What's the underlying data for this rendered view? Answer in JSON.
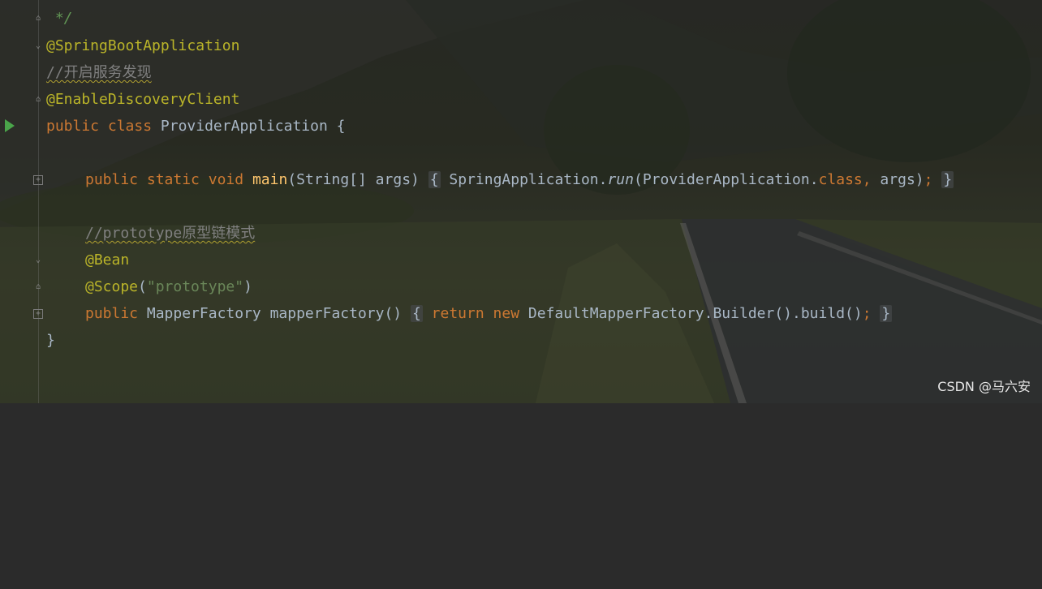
{
  "editor": {
    "lines": [
      {
        "text": " */"
      },
      {
        "text": "@SpringBootApplication"
      },
      {
        "text": "//开启服务发现"
      },
      {
        "text": "@EnableDiscoveryClient"
      },
      {
        "kw1": "public",
        "kw2": "class",
        "name": "ProviderApplication",
        "brace": "{"
      },
      {
        "kw1": "public",
        "kw2": "static",
        "kw3": "void",
        "fn": "main",
        "params": "(String[] args)",
        "open": "{",
        "call": " SpringApplication.",
        "method": "run",
        "args_a": "(ProviderApplication.",
        "kwclass": "class",
        "comma": ",",
        "args_b": " args)",
        "semi": ";",
        "close": "}"
      },
      {
        "text": "//prototype原型链模式"
      },
      {
        "text": "@Bean"
      },
      {
        "ann": "@Scope",
        "lp": "(",
        "str": "\"prototype\"",
        "rp": ")"
      },
      {
        "kw1": "public",
        "type": " MapperFactory mapperFactory()",
        "open": "{",
        "kwret": "return",
        "kwnew": "new",
        "rest": " DefaultMapperFactory.Builder().build()",
        "semi": ";",
        "close": "}"
      },
      {
        "text": "}"
      }
    ]
  },
  "watermark": "CSDN @马六安",
  "colors": {
    "annotation": "#bbb529",
    "keyword": "#cc7832",
    "comment": "#808080",
    "string": "#6a8759",
    "function": "#ffc66d",
    "text": "#a9b7c6",
    "run_arrow": "#4aa54a"
  }
}
